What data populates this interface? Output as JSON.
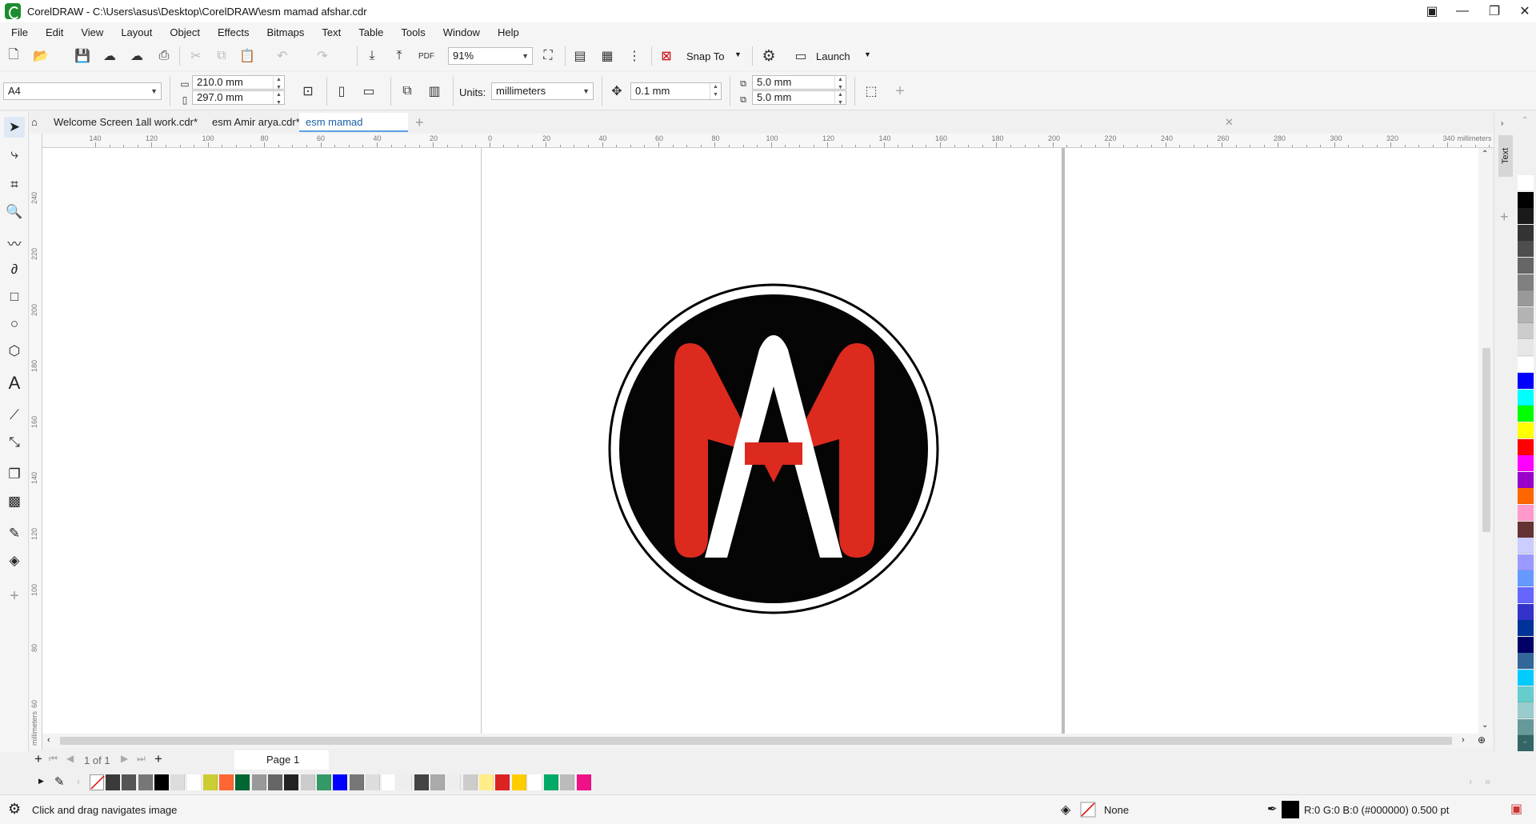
{
  "window": {
    "title": "CorelDRAW - C:\\Users\\asus\\Desktop\\CorelDRAW\\esm mamad afshar.cdr"
  },
  "menu": [
    "File",
    "Edit",
    "View",
    "Layout",
    "Object",
    "Effects",
    "Bitmaps",
    "Text",
    "Table",
    "Tools",
    "Window",
    "Help"
  ],
  "toolbar": {
    "zoom": "91%",
    "snap_to": "Snap To",
    "launch": "Launch",
    "pdf_label": "PDF"
  },
  "property_bar": {
    "page_size": "A4",
    "width": "210.0 mm",
    "height": "297.0 mm",
    "units_label": "Units:",
    "units": "millimeters",
    "nudge": "0.1 mm",
    "duplicate_x": "5.0 mm",
    "duplicate_y": "5.0 mm"
  },
  "tabs": [
    {
      "label": "Welcome Screen"
    },
    {
      "label": "1all work.cdr*"
    },
    {
      "label": "esm Amir arya.cdr*"
    },
    {
      "label": "esm mamad afshar.cdr"
    }
  ],
  "rulers": {
    "unit": "millimeters",
    "h_ticks": [
      "140",
      "120",
      "100",
      "80",
      "60",
      "40",
      "20",
      "0",
      "20",
      "40",
      "60",
      "80",
      "100",
      "120",
      "140",
      "160",
      "180",
      "200",
      "220",
      "240",
      "260",
      "280",
      "300",
      "320",
      "340"
    ],
    "v_ticks": [
      "240",
      "220",
      "200",
      "180",
      "160",
      "140",
      "120",
      "100",
      "80",
      "60"
    ]
  },
  "docker": {
    "tab_label": "Text"
  },
  "page_nav": {
    "counter": "1",
    "of": "of",
    "total": "1",
    "page_tab": "Page 1"
  },
  "statusbar": {
    "hint": "Click and drag navigates image",
    "fill": "None",
    "outline": "R:0 G:0 B:0 (#000000)  0.500 pt"
  },
  "colors": {
    "logo_red": "#dc2a1f",
    "logo_black": "#050505",
    "active_tab": "#1c5fa8"
  },
  "palette_right": [
    "#ffffff",
    "#000000",
    "#1a1a1a",
    "#333333",
    "#4d4d4d",
    "#666666",
    "#808080",
    "#999999",
    "#b3b3b3",
    "#cccccc",
    "#e6e6e6",
    "#ffffff",
    "#0000ff",
    "#00ffff",
    "#00ff00",
    "#ffff00",
    "#ff0000",
    "#ff00ff",
    "#9900cc",
    "#ff6600",
    "#ff99cc",
    "#663333",
    "#ccccff",
    "#9999ff",
    "#6699ff",
    "#6666ff",
    "#3333cc",
    "#003399",
    "#000066",
    "#336699",
    "#00ccff",
    "#66cccc",
    "#99cccc",
    "#669999",
    "#336666"
  ],
  "palette_bottom": [
    "#3a3a3a",
    "#555555",
    "#777777",
    "#000000",
    "#dddddd",
    "#ffffff",
    "#cccc33",
    "#ff6633",
    "#006633",
    "#999999",
    "#666666",
    "#222222",
    "#cccccc",
    "#339966",
    "#0000ff",
    "#777777",
    "#dddddd",
    "#ffffff",
    "#eeeeee",
    "#444444",
    "#aaaaaa",
    "#eeeeee",
    "#cccccc",
    "#ffee88",
    "#dd2222",
    "#ffcc00",
    "#ffffff",
    "#00aa66",
    "#bbbbbb",
    "#ee1188"
  ]
}
